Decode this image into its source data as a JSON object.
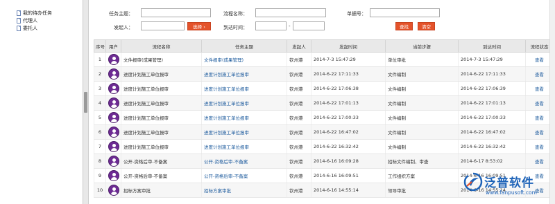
{
  "tree": {
    "items": [
      {
        "label": "我的待办任务"
      },
      {
        "label": "代理人"
      },
      {
        "label": "委托人"
      }
    ]
  },
  "search": {
    "task_subject_label": "任务主题：",
    "process_name_label": "流程名称：",
    "doc_no_label": "单据号：",
    "initiator_label": "发起人：",
    "select_button": "选择 ›",
    "arrival_time_label": "到达时间：",
    "range_sep": "-",
    "search_button": "查找",
    "clear_button": "清空"
  },
  "table": {
    "headers": [
      "序号",
      "用户",
      "流程名称",
      "任务主题",
      "发起人",
      "发起时间",
      "当前步骤",
      "到达时间",
      "流程状态"
    ],
    "rows": [
      {
        "no": "1",
        "process": "文件报审(成果管理)",
        "subject": "文件报审(成果管理)",
        "initiator": "钦州港",
        "start": "2014-7-3 15:47:29",
        "step": "单位审批",
        "arrive": "2014-7-3 15:47:29",
        "status": "查看"
      },
      {
        "no": "2",
        "process": "进度计划施工单位报审",
        "subject": "进度计划施工单位报审",
        "initiator": "钦州港",
        "start": "2014-6-22 17:11:33",
        "step": "文件编制",
        "arrive": "2014-6-22 17:11:33",
        "status": "查看"
      },
      {
        "no": "3",
        "process": "进度计划施工单位报审",
        "subject": "进度计划施工单位报审",
        "initiator": "钦州港",
        "start": "2014-6-22 17:06:38",
        "step": "文件编制",
        "arrive": "2014-6-22 17:06:39",
        "status": "查看"
      },
      {
        "no": "4",
        "process": "进度计划施工单位报审",
        "subject": "进度计划施工单位报审",
        "initiator": "钦州港",
        "start": "2014-6-22 17:01:13",
        "step": "文件编制",
        "arrive": "2014-6-22 17:01:13",
        "status": "查看"
      },
      {
        "no": "5",
        "process": "进度计划施工单位报审",
        "subject": "进度计划施工单位报审",
        "initiator": "钦州港",
        "start": "2014-6-22 17:00:33",
        "step": "文件编制",
        "arrive": "2014-6-22 17:00:33",
        "status": "查看"
      },
      {
        "no": "6",
        "process": "进度计划施工单位报审",
        "subject": "进度计划施工单位报审",
        "initiator": "钦州港",
        "start": "2014-6-22 16:47:02",
        "step": "文件编制",
        "arrive": "2014-6-22 16:47:02",
        "status": "查看"
      },
      {
        "no": "7",
        "process": "进度计划施工单位报审",
        "subject": "进度计划施工单位报审",
        "initiator": "钦州港",
        "start": "2014-6-22 16:32:42",
        "step": "文件编制",
        "arrive": "2014-6-22 16:32:42",
        "status": "查看"
      },
      {
        "no": "8",
        "process": "公开-资格后审-不备案",
        "subject": "公开-资格后审-不备案",
        "initiator": "钦州港",
        "start": "2014-6-16 16:09:28",
        "step": "招标文件编制、审查",
        "arrive": "2014-6-17 8:53:02",
        "status": "查看"
      },
      {
        "no": "9",
        "process": "公开-资格后审-不备案",
        "subject": "公开-资格后审-不备案",
        "initiator": "钦州港",
        "start": "2014-6-16 16:09:51",
        "step": "工作组织方案",
        "arrive": "2014-6-16 16:09:51",
        "status": "查看"
      },
      {
        "no": "10",
        "process": "招标方案审批",
        "subject": "招标方案审批",
        "initiator": "钦州港",
        "start": "2014-6-16 14:55:14",
        "step": "领导审批",
        "arrive": "2014-6-16 14:55:14",
        "status": "查看"
      }
    ]
  },
  "logo": {
    "name": "泛普软件",
    "url": "www.fanpusoft.com"
  },
  "colors": {
    "button": "#e4532b",
    "link": "#1f5c9e",
    "header_bg": "#e9e9e9",
    "user_icon": "#6d2b93",
    "logo": "#1e63b8"
  }
}
